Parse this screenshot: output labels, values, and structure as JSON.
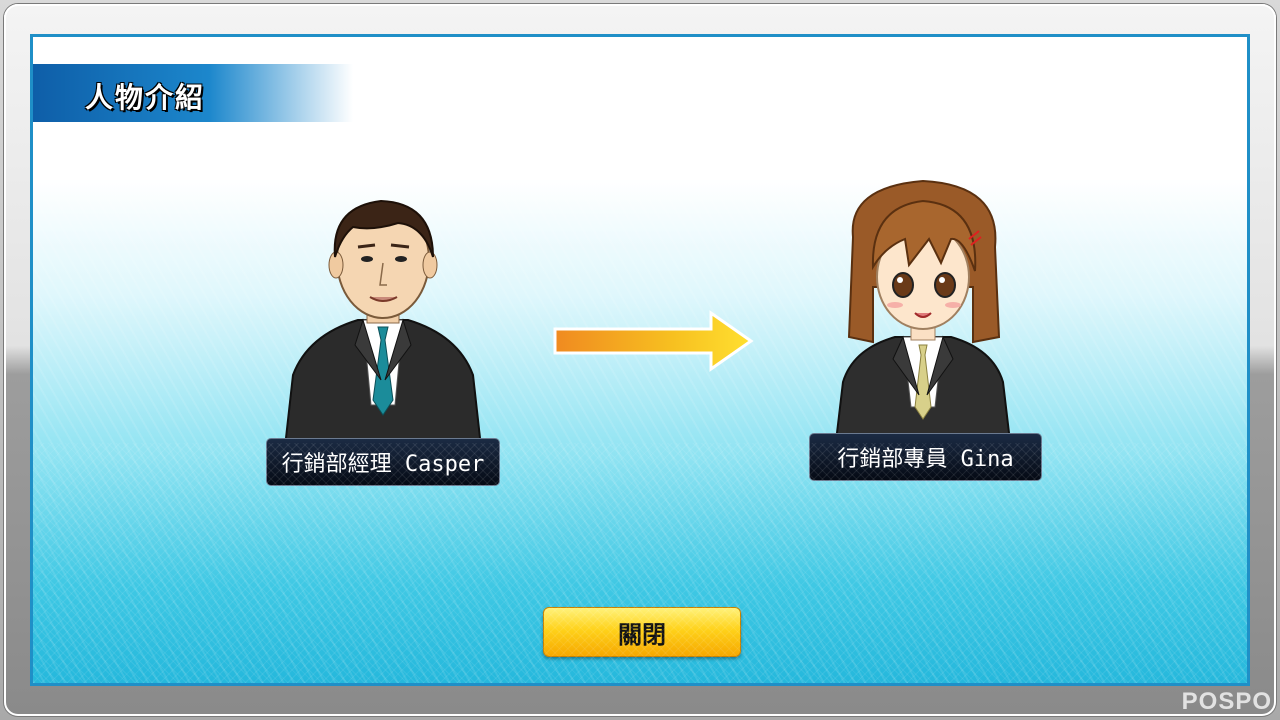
{
  "header": {
    "title": "人物介紹"
  },
  "characters": [
    {
      "label": "行銷部經理 Casper"
    },
    {
      "label": "行銷部專員 Gina"
    }
  ],
  "actions": {
    "close_label": "關閉"
  },
  "watermark": "POSPO",
  "colors": {
    "panel_border": "#1f8fc7",
    "header_bar": "#1c87cc",
    "button_yellow": "#ffd21a",
    "arrow_orange": "#f0a020"
  }
}
